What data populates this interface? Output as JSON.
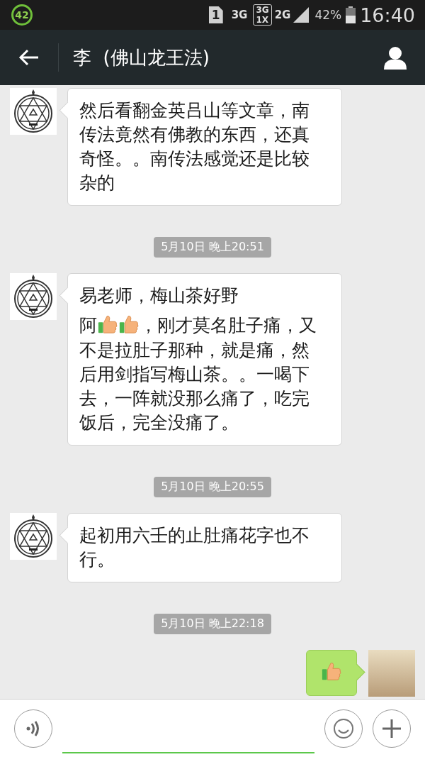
{
  "status_bar": {
    "badge": "42",
    "sim": "1",
    "network_1": "3G",
    "network_2_top": "3G",
    "network_2_bottom": "1X",
    "network_3": "2G",
    "battery": "42%",
    "time": "16:40"
  },
  "header": {
    "title": "李  (佛山龙王法)"
  },
  "messages": [
    {
      "kind": "incoming",
      "parts": [
        {
          "kind": "text",
          "text": "然后看翻金英吕山等文章，南传法竟然有佛教的东西，还真奇怪。。南传法感觉还是比较杂的"
        }
      ]
    },
    {
      "kind": "time",
      "text": "5月10日 晚上20:51"
    },
    {
      "kind": "incoming",
      "parts": [
        {
          "kind": "text",
          "text": "易老师，梅山茶好野"
        },
        {
          "kind": "break"
        },
        {
          "kind": "text",
          "text": "阿"
        },
        {
          "kind": "thumb"
        },
        {
          "kind": "thumb"
        },
        {
          "kind": "text",
          "text": "，刚才莫名肚子痛，又"
        },
        {
          "kind": "text",
          "text": "不是拉肚子那种，就是痛，然后用剑指写梅山茶。。一喝下去，一阵就没那么痛了，吃完饭后，完全没痛了。"
        }
      ]
    },
    {
      "kind": "time",
      "text": "5月10日 晚上20:55"
    },
    {
      "kind": "incoming",
      "parts": [
        {
          "kind": "text",
          "text": "起初用六壬的止肚痛花字也不行。"
        }
      ]
    },
    {
      "kind": "time",
      "text": "5月10日 晚上22:18"
    },
    {
      "kind": "outgoing",
      "parts": [
        {
          "kind": "thumb"
        }
      ]
    }
  ]
}
